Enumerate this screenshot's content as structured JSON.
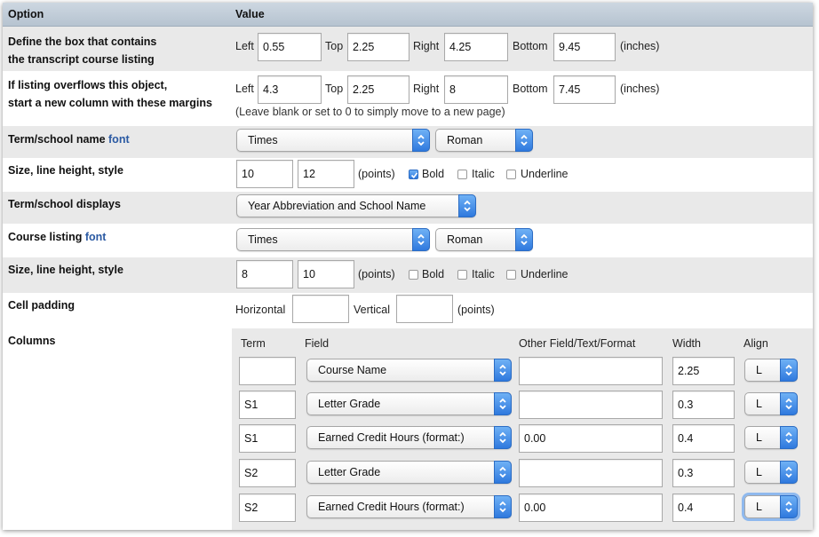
{
  "header": {
    "option": "Option",
    "value": "Value"
  },
  "box": {
    "label1": "Define the box that contains",
    "label2": "the transcript course listing",
    "left_label": "Left",
    "left": "0.55",
    "top_label": "Top",
    "top": "2.25",
    "right_label": "Right",
    "right": "4.25",
    "bottom_label": "Bottom",
    "bottom": "9.45",
    "unit": "(inches)"
  },
  "overflow": {
    "label1": "If listing overflows this object,",
    "label2": "start a new column with these margins",
    "left_label": "Left",
    "left": "4.3",
    "top_label": "Top",
    "top": "2.25",
    "right_label": "Right",
    "right": "8",
    "bottom_label": "Bottom",
    "bottom": "7.45",
    "unit": "(inches)",
    "note": "(Leave blank or set to 0 to simply move to a new page)"
  },
  "term_font": {
    "label": "Term/school name",
    "link": "font",
    "family": "Times",
    "style": "Roman"
  },
  "term_size": {
    "label": "Size, line height, style",
    "size": "10",
    "line_height": "12",
    "unit": "(points)",
    "bold_label": "Bold",
    "bold": true,
    "italic_label": "Italic",
    "italic": false,
    "underline_label": "Underline",
    "underline": false
  },
  "term_displays": {
    "label": "Term/school displays",
    "value": "Year Abbreviation and School Name"
  },
  "course_font": {
    "label": "Course listing",
    "link": "font",
    "family": "Times",
    "style": "Roman"
  },
  "course_size": {
    "label": "Size, line height, style",
    "size": "8",
    "line_height": "10",
    "unit": "(points)",
    "bold_label": "Bold",
    "bold": false,
    "italic_label": "Italic",
    "italic": false,
    "underline_label": "Underline",
    "underline": false
  },
  "cell_padding": {
    "label": "Cell padding",
    "horizontal_label": "Horizontal",
    "horizontal": "",
    "vertical_label": "Vertical",
    "vertical": "",
    "unit": "(points)"
  },
  "columns": {
    "label": "Columns",
    "headers": {
      "term": "Term",
      "field": "Field",
      "other": "Other Field/Text/Format",
      "width": "Width",
      "align": "Align"
    },
    "rows": [
      {
        "term": "",
        "field": "Course Name",
        "other": "",
        "width": "2.25",
        "align": "L"
      },
      {
        "term": "S1",
        "field": "Letter Grade",
        "other": "",
        "width": "0.3",
        "align": "L"
      },
      {
        "term": "S1",
        "field": "Earned Credit Hours (format:)",
        "other": "0.00",
        "width": "0.4",
        "align": "L"
      },
      {
        "term": "S2",
        "field": "Letter Grade",
        "other": "",
        "width": "0.3",
        "align": "L"
      },
      {
        "term": "S2",
        "field": "Earned Credit Hours (format:)",
        "other": "0.00",
        "width": "0.4",
        "align": "L"
      }
    ]
  },
  "colors": {
    "header_bg": "#c3cfdb",
    "row_alt_bg": "#e9e9e9",
    "link": "#2b5aa3",
    "select_arrow": "#3b84e4"
  }
}
